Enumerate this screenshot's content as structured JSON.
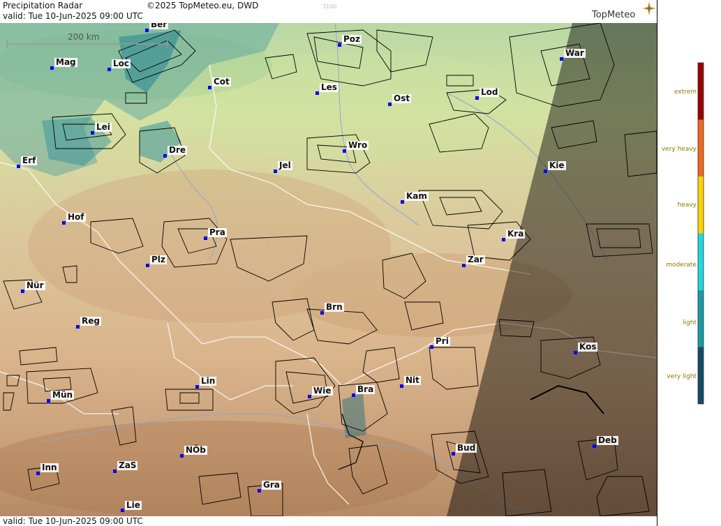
{
  "header": {
    "title": "Precipitation Radar",
    "copyright": "©2025 TopMeteo.eu, DWD",
    "valid": "valid:  Tue  10-Jun-2025 09:00 UTC",
    "small_code": "3100",
    "logo": "TopMeteo"
  },
  "footer": {
    "valid": "valid:  Tue  10-Jun-2025 09:00 UTC"
  },
  "scale_bar": {
    "label": "200 km"
  },
  "cities": [
    {
      "name": "Ber"
    },
    {
      "name": "Poz"
    },
    {
      "name": "War"
    },
    {
      "name": "Mag"
    },
    {
      "name": "Loc"
    },
    {
      "name": "Cot"
    },
    {
      "name": "Les"
    },
    {
      "name": "Ost"
    },
    {
      "name": "Lod"
    },
    {
      "name": "Lei"
    },
    {
      "name": "Dre"
    },
    {
      "name": "Wro"
    },
    {
      "name": "Erf"
    },
    {
      "name": "Jel"
    },
    {
      "name": "Kie"
    },
    {
      "name": "Kam"
    },
    {
      "name": "Hof"
    },
    {
      "name": "Pra"
    },
    {
      "name": "Kra"
    },
    {
      "name": "Plz"
    },
    {
      "name": "Zar"
    },
    {
      "name": "Nür"
    },
    {
      "name": "Brn"
    },
    {
      "name": "Reg"
    },
    {
      "name": "Pri"
    },
    {
      "name": "Kos"
    },
    {
      "name": "Lin"
    },
    {
      "name": "Nit"
    },
    {
      "name": "Mün"
    },
    {
      "name": "Wie"
    },
    {
      "name": "Bra"
    },
    {
      "name": "Bud"
    },
    {
      "name": "Deb"
    },
    {
      "name": "NÖb"
    },
    {
      "name": "Inn"
    },
    {
      "name": "ZaS"
    },
    {
      "name": "Gra"
    },
    {
      "name": "Lie"
    }
  ],
  "legend": {
    "items": [
      {
        "label": "extrem",
        "color": "#990000"
      },
      {
        "label": "very heavy",
        "color": "#ee6a1e"
      },
      {
        "label": "heavy",
        "color": "#ffd400"
      },
      {
        "label": "moderate",
        "color": "#22d8e0"
      },
      {
        "label": "light",
        "color": "#1c9aa6"
      },
      {
        "label": "very light",
        "color": "#124d66"
      }
    ]
  }
}
